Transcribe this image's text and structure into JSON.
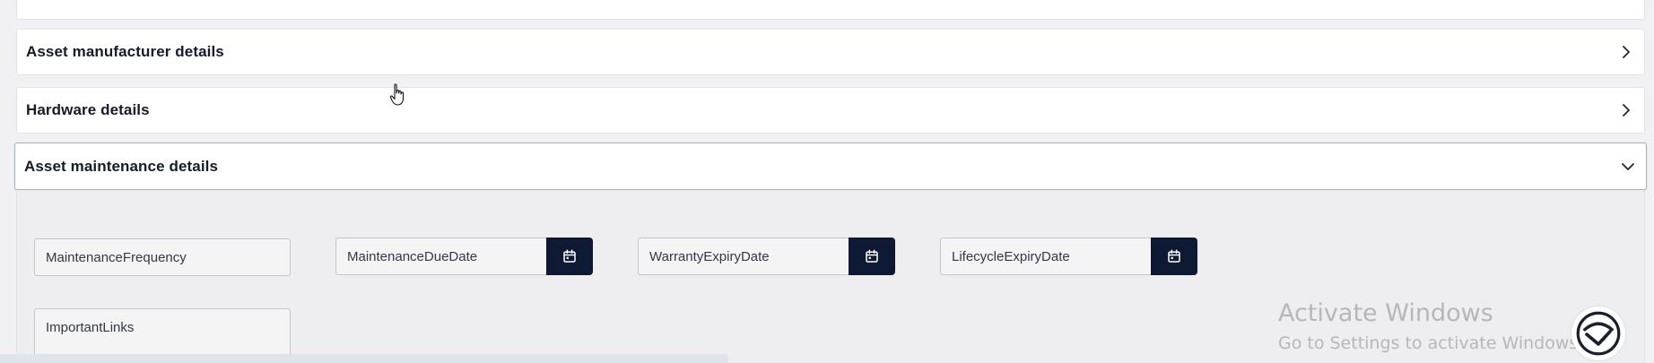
{
  "sections": [
    {
      "title": "Asset manufacturer details",
      "state": "collapsed",
      "icon": "chevron-right-icon"
    },
    {
      "title": "Hardware details",
      "state": "collapsed",
      "icon": "chevron-right-icon"
    },
    {
      "title": "Asset maintenance details",
      "state": "expanded",
      "icon": "chevron-down-icon"
    }
  ],
  "maintenance_fields": {
    "maintenance_frequency": {
      "placeholder": "MaintenanceFrequency"
    },
    "maintenance_due_date": {
      "placeholder": "MaintenanceDueDate",
      "icon": "calendar-icon"
    },
    "warranty_expiry_date": {
      "placeholder": "WarrantyExpiryDate",
      "icon": "calendar-icon"
    },
    "lifecycle_expiry_date": {
      "placeholder": "LifecycleExpiryDate",
      "icon": "calendar-icon"
    },
    "important_links": {
      "placeholder": "ImportantLinks"
    }
  },
  "watermark": {
    "title": "Activate Windows",
    "subtitle": "Go to Settings to activate Windows."
  },
  "colors": {
    "calendar_button": "#0e1a33",
    "panel_bg": "#ffffff",
    "page_bg": "#f1f1f3",
    "expanded_border": "#9fb0c9"
  }
}
